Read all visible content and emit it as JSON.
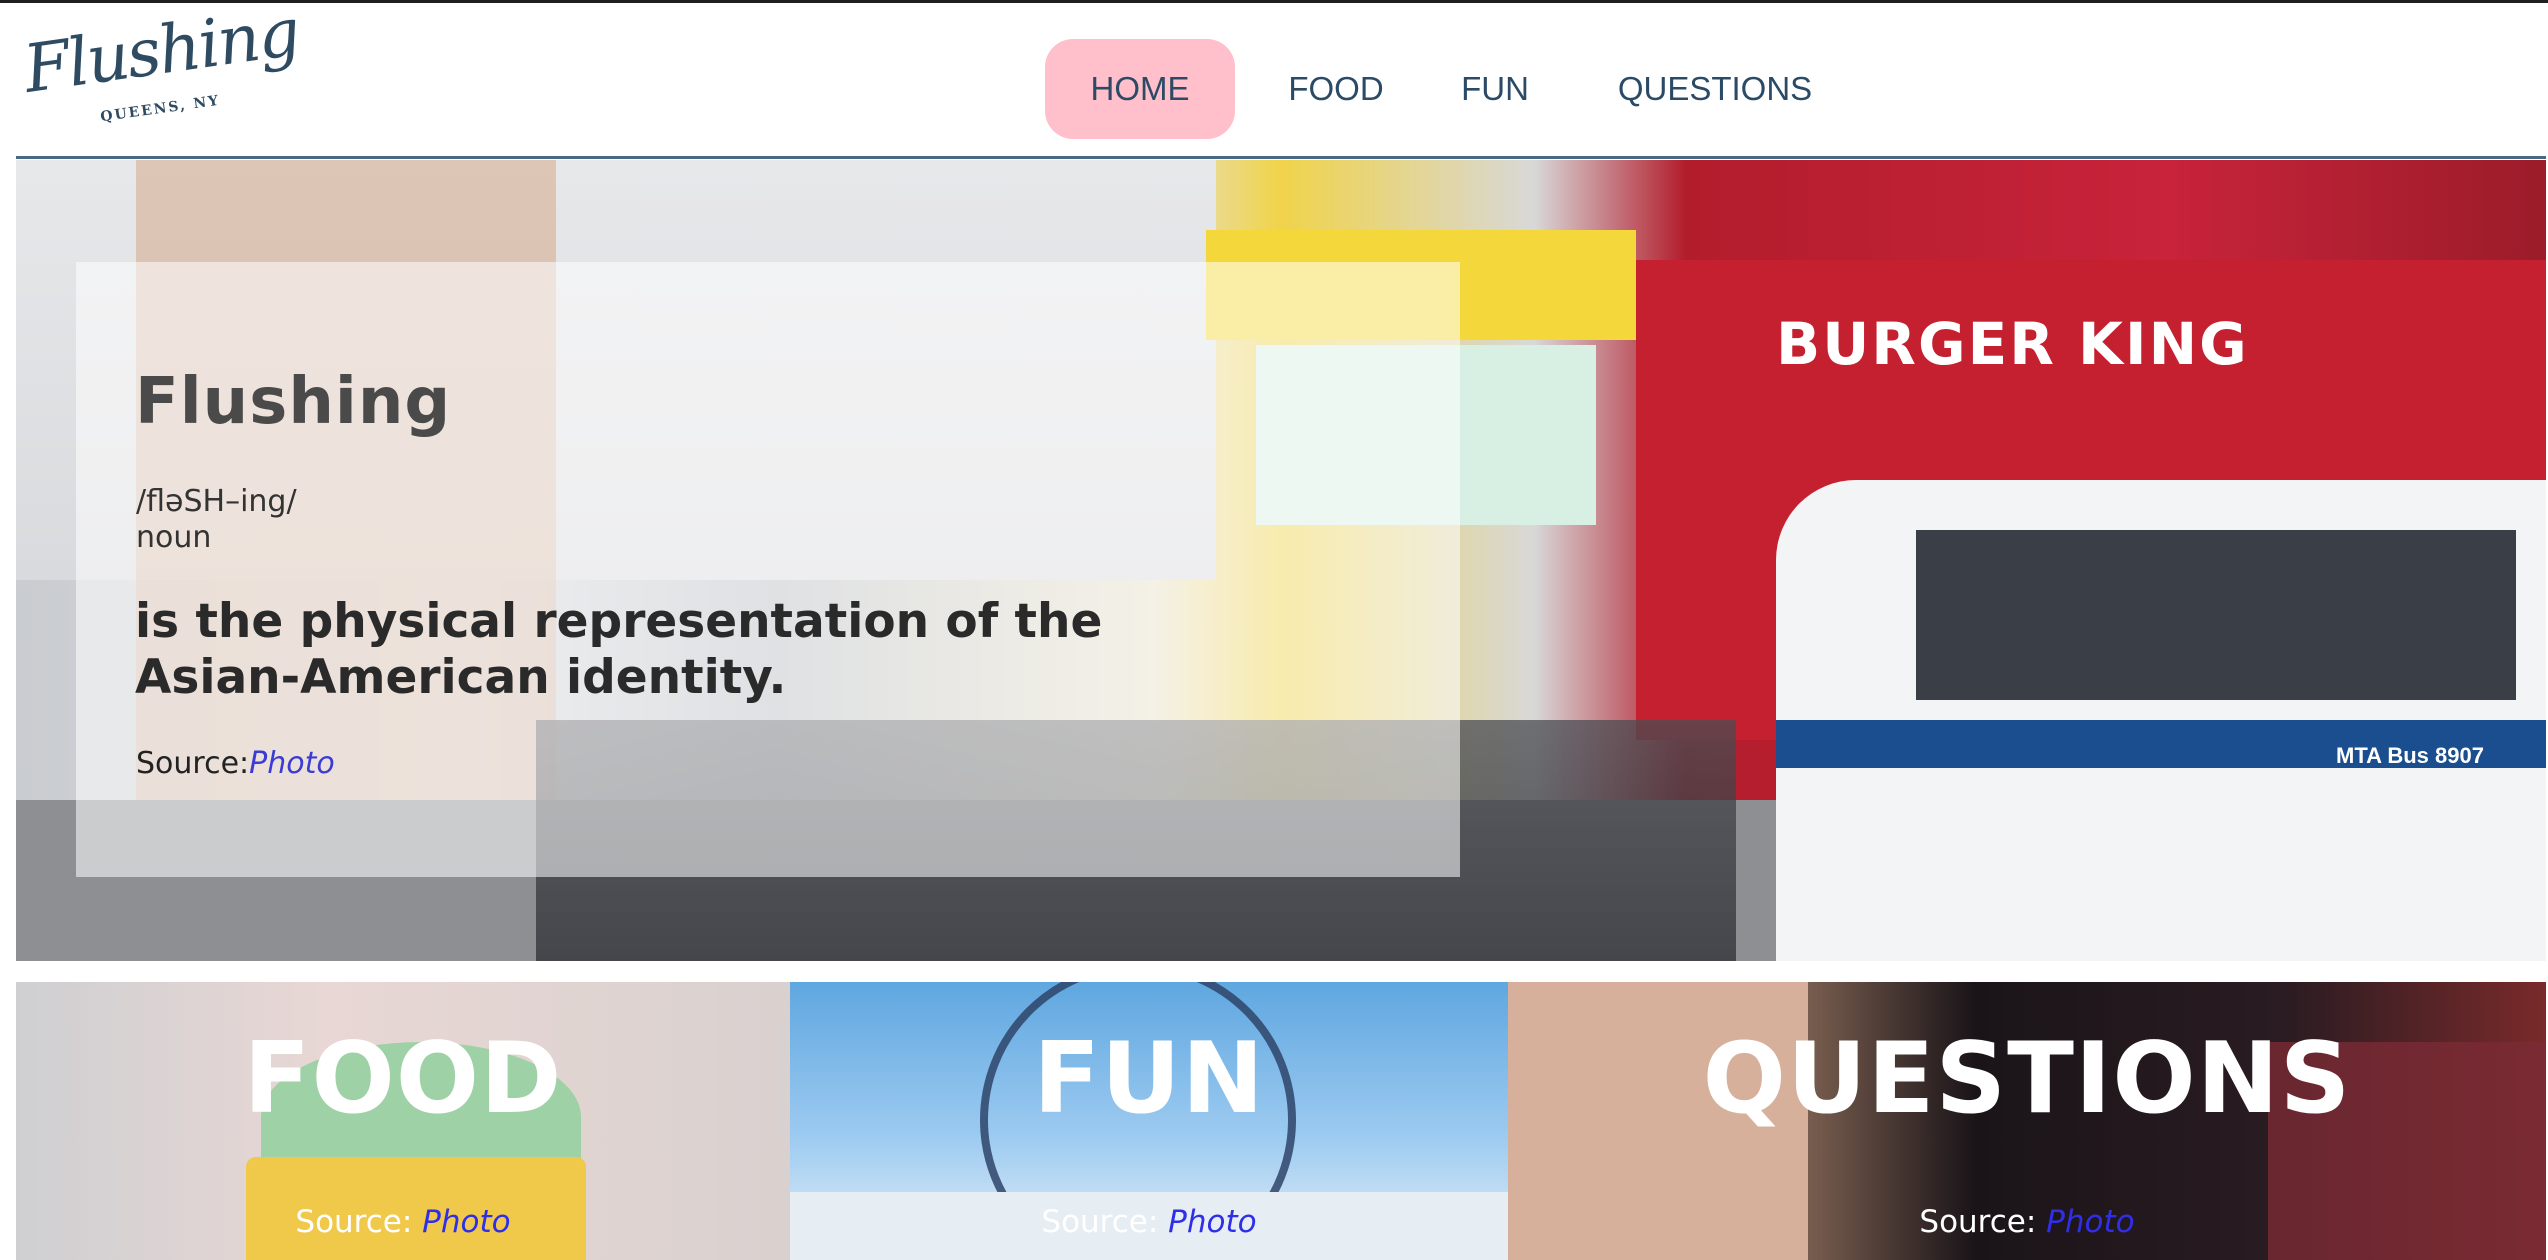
{
  "brand": {
    "script": "Flushing",
    "subtitle": "QUEENS, NY"
  },
  "nav": {
    "items": [
      {
        "label": "HOME",
        "active": true
      },
      {
        "label": "FOOD",
        "active": false
      },
      {
        "label": "FUN",
        "active": false
      },
      {
        "label": "QUESTIONS",
        "active": false
      }
    ]
  },
  "hero": {
    "title": "Flushing",
    "pronunciation": "/fləSH–ing/",
    "part_of_speech": "noun",
    "definition": "is the physical representation of the Asian-American identity.",
    "source_label": "Source:",
    "source_link": "Photo",
    "photo_signs": {
      "restaurant": "BURGER KING",
      "bus": "MTA Bus 8907"
    }
  },
  "tiles": [
    {
      "title": "FOOD",
      "source_label": "Source:",
      "source_link": "Photo"
    },
    {
      "title": "FUN",
      "source_label": "Source:",
      "source_link": "Photo"
    },
    {
      "title": "QUESTIONS",
      "source_label": "Source:",
      "source_link": "Photo"
    }
  ],
  "colors": {
    "nav_text": "#2b4a66",
    "nav_active_bg": "#ffc0cb",
    "header_rule": "#456a82",
    "link": "#3b3bd6"
  }
}
